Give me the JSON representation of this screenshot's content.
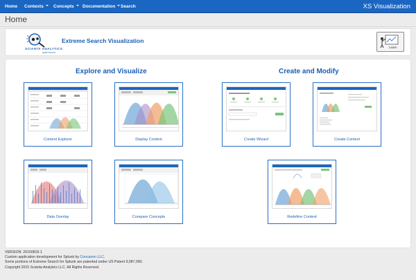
{
  "nav": {
    "items": [
      {
        "label": "Home",
        "has_dropdown": false
      },
      {
        "label": "Contexts",
        "has_dropdown": true
      },
      {
        "label": "Concepts",
        "has_dropdown": true
      },
      {
        "label": "Documentation",
        "has_dropdown": true
      },
      {
        "label": "Search",
        "has_dropdown": false
      }
    ],
    "app_title": "XS Visualization",
    "bar_color": "#1a66c2"
  },
  "page": {
    "title": "Home"
  },
  "header": {
    "logo_text": "SCIANTA ANALYTICS",
    "logo_subtext": "DEEP INSIGHT",
    "title": "Extreme Search Visualization",
    "learn_label": "Learn"
  },
  "sections": {
    "explore": "Explore and Visualize",
    "create": "Create and Modify"
  },
  "cards": [
    {
      "label": "Context Explorer",
      "thumb": "explorer-table"
    },
    {
      "label": "Display Context",
      "thumb": "bell-curves"
    },
    {
      "label": "Create Wizard",
      "thumb": "wizard-form"
    },
    {
      "label": "Create Context",
      "thumb": "context-form"
    },
    {
      "label": "Data Overlay",
      "thumb": "data-overlay"
    },
    {
      "label": "Compare Concepts",
      "thumb": "compare-curves"
    },
    {
      "label": "Redefine Context",
      "thumb": "redefine-curves"
    }
  ],
  "footer": {
    "version": "VERSION: 20150816-1",
    "custom_prefix": "Custom application development for Splunk by ",
    "custom_link": "Concanon LLC",
    "custom_suffix": ".",
    "patent": "Some portions of Extreme Search for Splunk are patented under US Patent 9,087,090.",
    "copyright": "Copyright 2015 Scianta Analytics LLC. All Rights Reserved."
  },
  "colors": {
    "accent": "#1a5fb4",
    "card_border": "#2a72c8",
    "curve_blue": "#6fa6d6",
    "curve_purple": "#a88fc9",
    "curve_orange": "#f0a068",
    "curve_green": "#7cc47a"
  }
}
